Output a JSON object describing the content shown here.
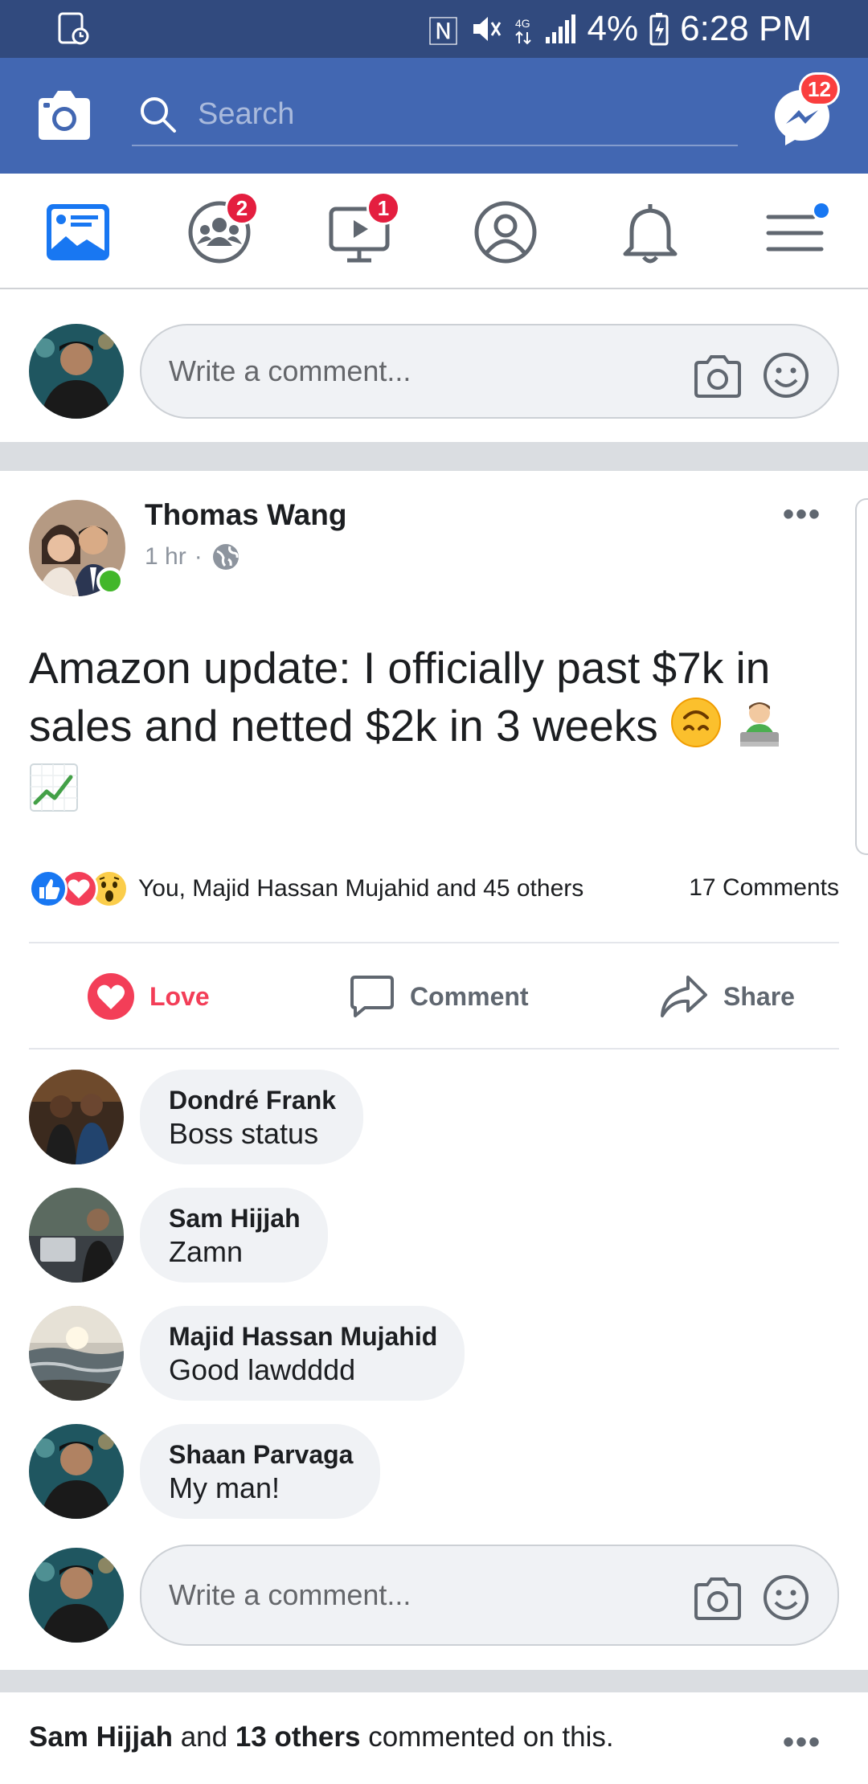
{
  "status_bar": {
    "battery": "4%",
    "time": "6:28 PM"
  },
  "header": {
    "search_placeholder": "Search",
    "messenger_badge": "12"
  },
  "tabs": {
    "groups_badge": "2",
    "watch_badge": "1"
  },
  "composer": {
    "placeholder": "Write a comment..."
  },
  "post": {
    "author": "Thomas Wang",
    "time": "1 hr",
    "text": "Amazon update: I officially past $7k in sales and netted $2k in 3 weeks",
    "reactions_text": "You, Majid Hassan Mujahid and 45 others",
    "comments_count": "17 Comments",
    "actions": {
      "love": "Love",
      "comment": "Comment",
      "share": "Share"
    },
    "comments": [
      {
        "name": "Dondré Frank",
        "text": "Boss status"
      },
      {
        "name": "Sam Hijjah",
        "text": "Zamn"
      },
      {
        "name": "Majid Hassan Mujahid",
        "text": "Good lawdddd"
      },
      {
        "name": "Shaan Parvaga",
        "text": "My man!"
      }
    ]
  },
  "next_story": {
    "name": "Sam Hijjah",
    "mid": "and",
    "others": "13 others",
    "suffix": "commented on this."
  },
  "colors": {
    "status_bar": "#314a7e",
    "header_blue": "#4267b2",
    "love_red": "#f33e58",
    "badge_red": "#e41e3f"
  }
}
